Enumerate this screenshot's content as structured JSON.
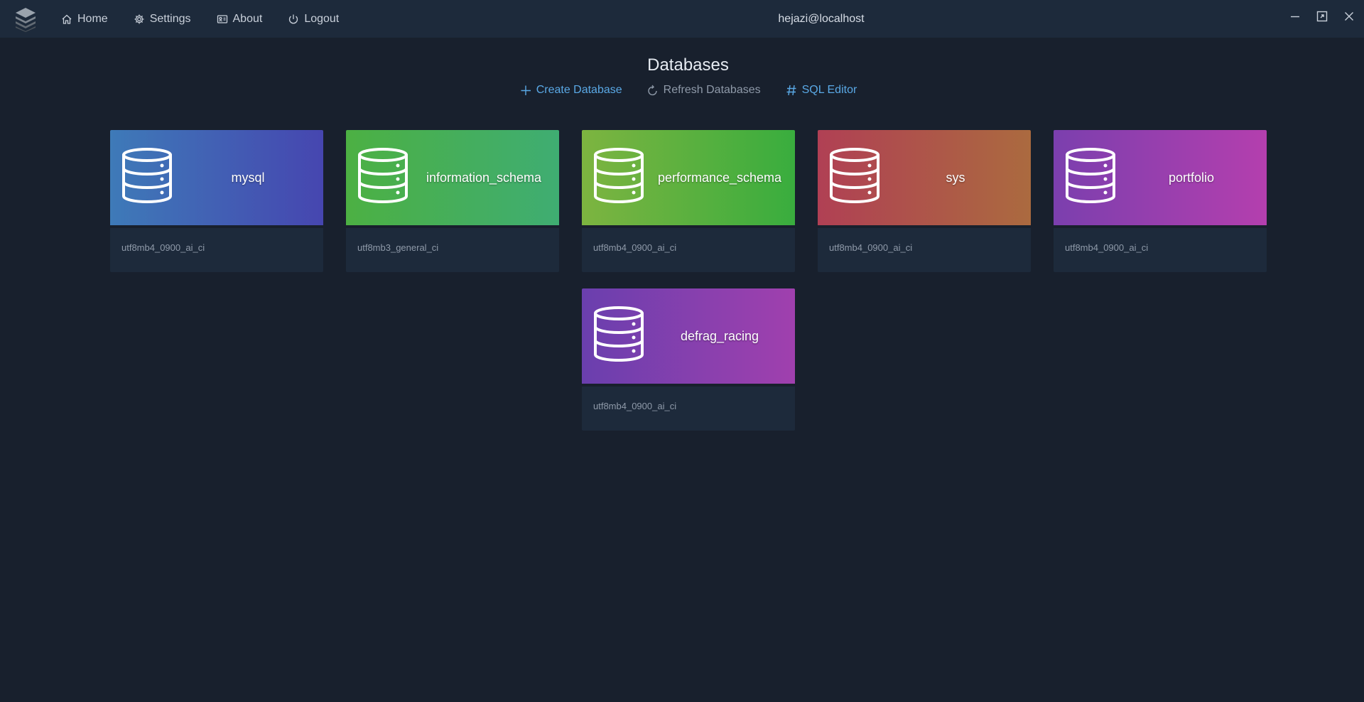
{
  "nav": {
    "home": "Home",
    "settings": "Settings",
    "about": "About",
    "logout": "Logout"
  },
  "user": "hejazi@localhost",
  "page": {
    "title": "Databases",
    "actions": {
      "create": "Create Database",
      "refresh": "Refresh Databases",
      "sql": "SQL Editor"
    }
  },
  "colors": {
    "accent": "#5aa9e6",
    "muted": "#8f9aa9",
    "background": "#18202d",
    "panel": "#1d2a3b"
  },
  "databases": [
    {
      "name": "mysql",
      "collation": "utf8mb4_0900_ai_ci",
      "gradient": [
        "#3e7ab8",
        "#4646b0"
      ]
    },
    {
      "name": "information_schema",
      "collation": "utf8mb3_general_ci",
      "gradient": [
        "#4cb043",
        "#3fad72"
      ]
    },
    {
      "name": "performance_schema",
      "collation": "utf8mb4_0900_ai_ci",
      "gradient": [
        "#7db440",
        "#39ad3e"
      ]
    },
    {
      "name": "sys",
      "collation": "utf8mb4_0900_ai_ci",
      "gradient": [
        "#b04054",
        "#ab6a3f"
      ]
    },
    {
      "name": "portfolio",
      "collation": "utf8mb4_0900_ai_ci",
      "gradient": [
        "#7b3fae",
        "#b43fae"
      ]
    },
    {
      "name": "defrag_racing",
      "collation": "utf8mb4_0900_ai_ci",
      "gradient": [
        "#6a3fae",
        "#a040ae"
      ]
    }
  ]
}
